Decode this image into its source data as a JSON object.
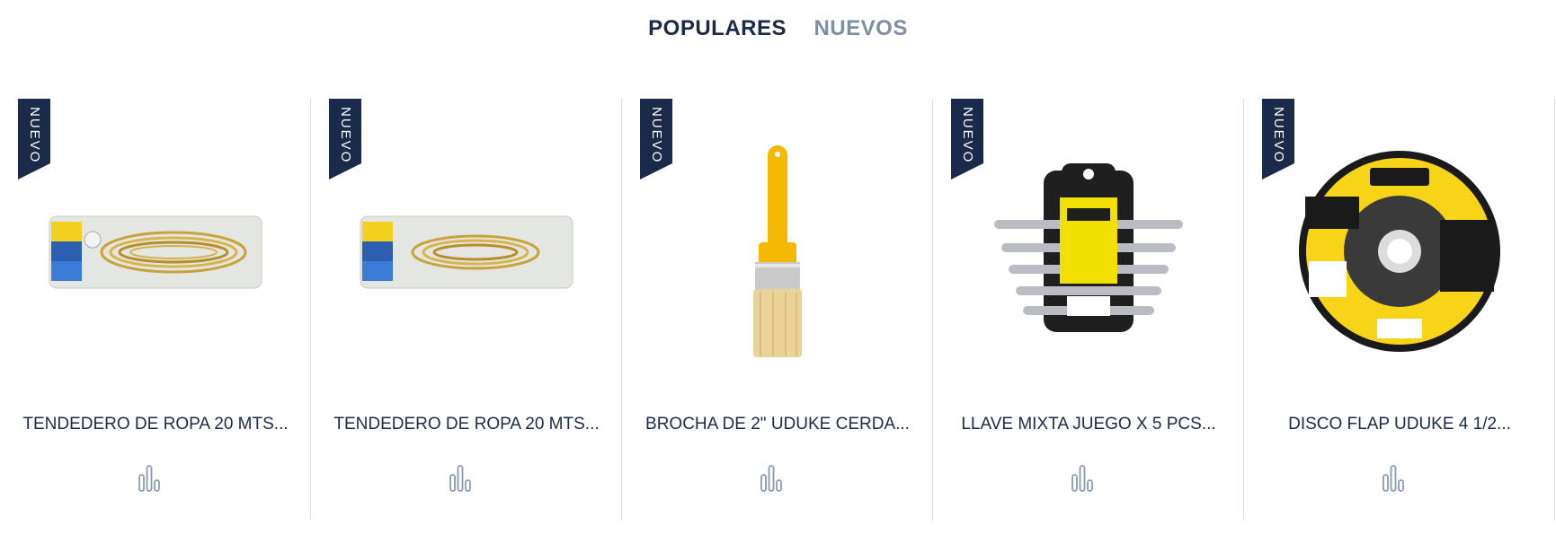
{
  "tabs": [
    {
      "label": "POPULARES",
      "active": true
    },
    {
      "label": "NUEVOS",
      "active": false
    }
  ],
  "products": [
    {
      "badge": "NUEVO",
      "title": "TENDEDERO DE ROPA 20 MTS...",
      "image": "clothesline-package"
    },
    {
      "badge": "NUEVO",
      "title": "TENDEDERO DE ROPA 20 MTS...",
      "image": "clothesline-package"
    },
    {
      "badge": "NUEVO",
      "title": "BROCHA DE 2\" UDUKE CERDA...",
      "image": "paint-brush"
    },
    {
      "badge": "NUEVO",
      "title": "LLAVE MIXTA JUEGO X 5 PCS...",
      "image": "wrench-set"
    },
    {
      "badge": "NUEVO",
      "title": "DISCO FLAP UDUKE 4 1/2...",
      "image": "flap-disc"
    }
  ],
  "icons": {
    "compare": "compare-chart-icon"
  },
  "colors": {
    "primary": "#1c2a47",
    "inactive": "#7e8ea6",
    "badge": "#1a2a4a",
    "divider": "#d9dde3",
    "brand_yellow": "#f7d417"
  }
}
